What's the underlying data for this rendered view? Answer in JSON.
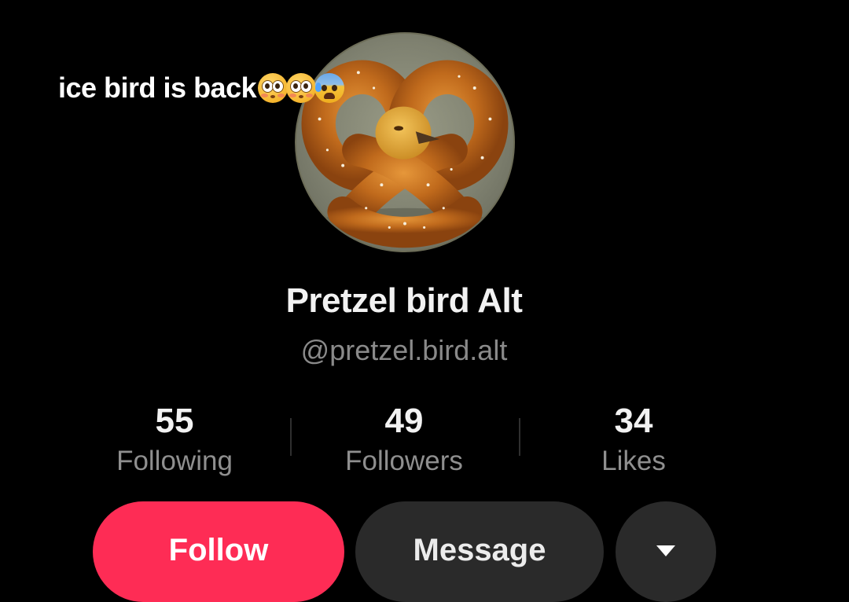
{
  "overlay": {
    "caption": "ice bird is back",
    "emojis": [
      "flushed-face",
      "flushed-face",
      "anxious-face-with-sweat"
    ]
  },
  "profile": {
    "avatar_description_icon": "pretzel-bird-avatar",
    "display_name": "Pretzel bird Alt",
    "handle": "@pretzel.bird.alt"
  },
  "stats": {
    "following": {
      "value": "55",
      "label": "Following"
    },
    "followers": {
      "value": "49",
      "label": "Followers"
    },
    "likes": {
      "value": "34",
      "label": "Likes"
    }
  },
  "actions": {
    "follow_label": "Follow",
    "message_label": "Message",
    "more_icon": "caret-down-icon"
  },
  "colors": {
    "background": "#000000",
    "follow_button": "#fe2c55",
    "secondary_button": "#2a2a2a",
    "muted_text": "#8a8a8a"
  }
}
